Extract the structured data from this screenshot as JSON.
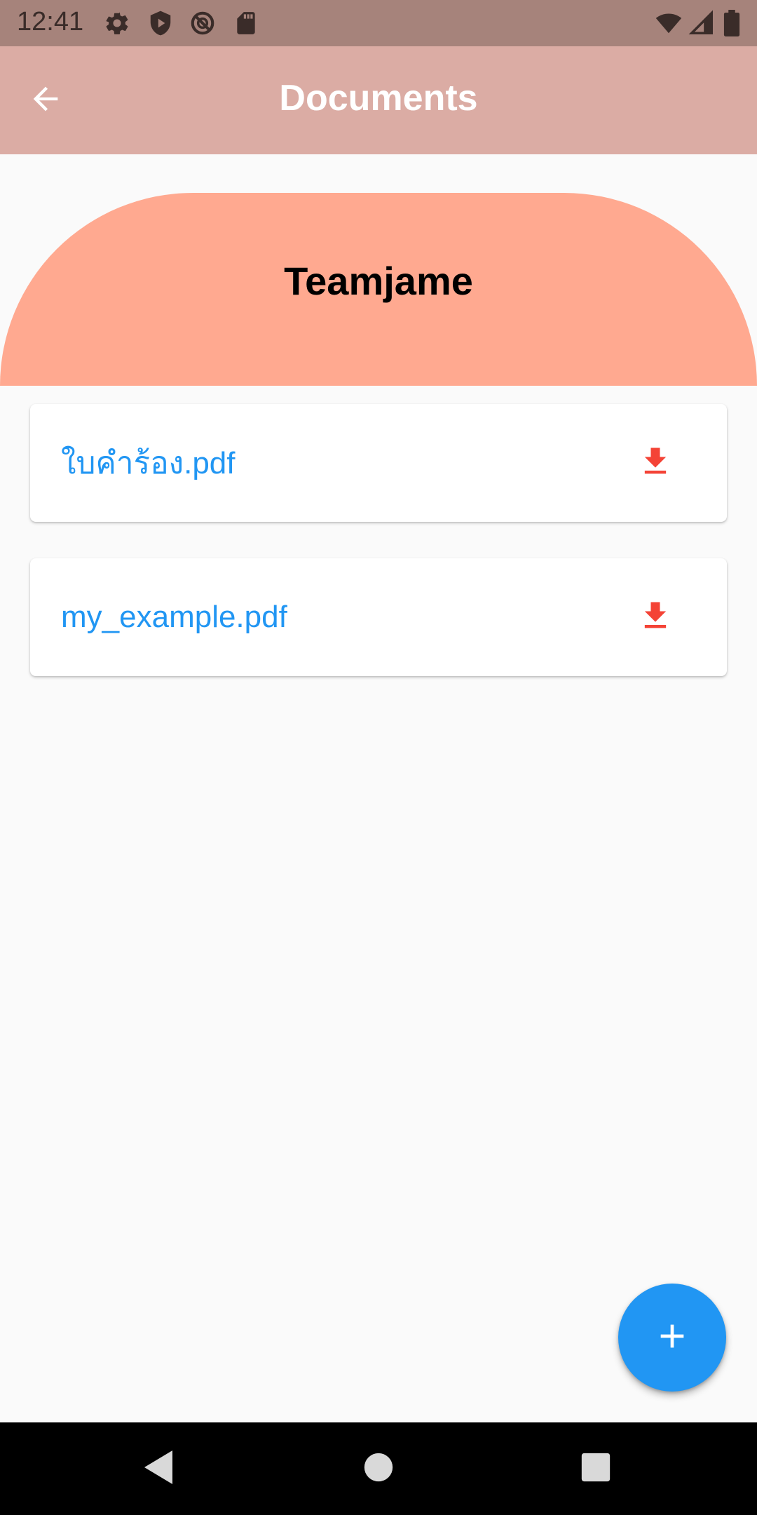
{
  "status_bar": {
    "time": "12:41",
    "left_icons": [
      "gear-icon",
      "shield-play-icon",
      "no-sync-icon",
      "sd-card-icon"
    ],
    "right_icons": [
      "wifi-icon",
      "signal-icon",
      "battery-icon"
    ]
  },
  "app_bar": {
    "title": "Documents",
    "back_icon": "arrow-back-icon"
  },
  "banner": {
    "team_name": "Teamjame",
    "color": "#ffa990"
  },
  "documents": [
    {
      "name": "ใบคำร้อง.pdf",
      "action_icon": "download-icon"
    },
    {
      "name": "my_example.pdf",
      "action_icon": "download-icon"
    }
  ],
  "fab": {
    "icon": "plus-icon",
    "color": "#2196f3"
  },
  "nav_bar": {
    "buttons": [
      "back-triangle-icon",
      "home-circle-icon",
      "recents-square-icon"
    ]
  },
  "colors": {
    "status_bar": "#a6837b",
    "app_bar": "#dbaca4",
    "link": "#2196f3",
    "download": "#f44336",
    "background": "#fafafa"
  }
}
